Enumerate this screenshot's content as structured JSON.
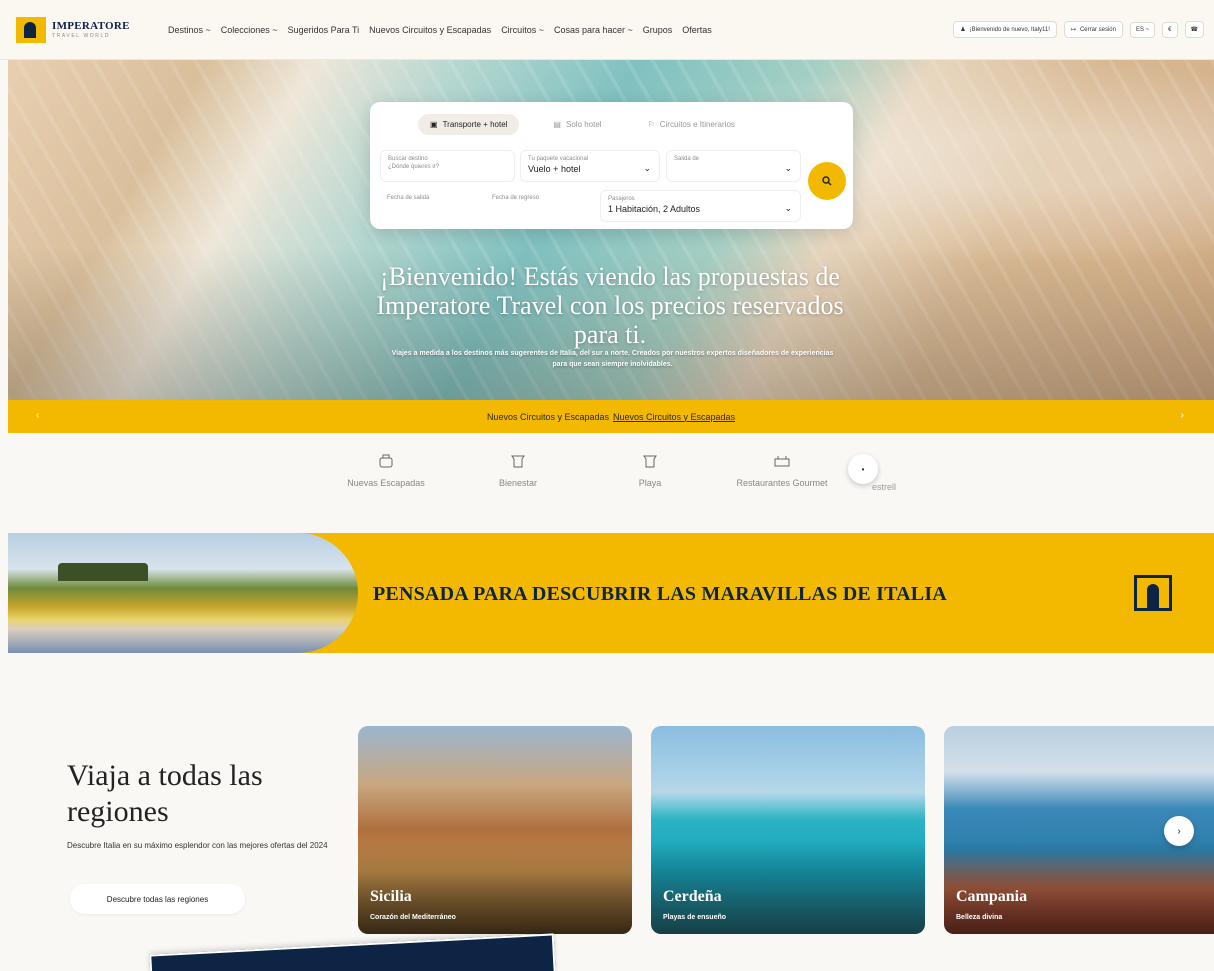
{
  "header": {
    "logo": {
      "name": "IMPERATORE",
      "sub": "TRAVEL WORLD"
    },
    "nav": [
      "Destinos ~",
      "Colecciones ~",
      "Sugeridos Para Ti",
      "Nuevos Circuitos y Escapadas",
      "Circuitos ~",
      "Cosas para hacer ~",
      "Grupos",
      "Ofertas"
    ],
    "welcome": "¡Bienvenido de nuevo, Italy11!",
    "logout": "Cerrar sesión",
    "lang": "ES ~",
    "currency": "€"
  },
  "hero": {
    "tabs": [
      "Transporte + hotel",
      "Solo hotel",
      "Circuitos e Itinerarios"
    ],
    "fields": {
      "destination": {
        "label": "Buscar destino",
        "placeholder": "¿Dónde quieres ir?"
      },
      "package": {
        "label": "Tu paquete vacacional",
        "value": "Vuelo + hotel"
      },
      "departure": {
        "label": "Salida de",
        "value": ""
      },
      "date_out": {
        "label": "Fecha de salida"
      },
      "date_back": {
        "label": "Fecha de regreso"
      },
      "passengers": {
        "label": "Pasajeros",
        "value": "1 Habitación, 2 Adultos"
      }
    },
    "title": "¡Bienvenido! Estás viendo las propuestas de Imperatore Travel con los precios reservados para ti.",
    "subtitle": "Viajes a medida a los destinos más sugerentes de Italia, del sur a norte. Creados por nuestros expertos diseñadores de experiencias para que sean siempre inolvidables."
  },
  "promo": {
    "text": "Nuevos Circuitos y Escapadas",
    "link": "Nuevos Circuitos y Escapadas"
  },
  "categories": [
    "Nuevas Escapadas",
    "Bienestar",
    "Playa",
    "Restaurantes Gourmet"
  ],
  "category_peek": "estrell",
  "banner": {
    "title": "PENSADA PARA DESCUBRIR LAS MARAVILLAS DE ITALIA"
  },
  "regions": {
    "title": "Viaja a todas las regiones",
    "description": "Descubre Italia en su máximo esplendor con las mejores ofertas del 2024",
    "button": "Descubre todas las regiones",
    "cards": [
      {
        "name": "Sicilia",
        "subtitle": "Corazón del Mediterráneo"
      },
      {
        "name": "Cerdeña",
        "subtitle": "Playas de ensueño"
      },
      {
        "name": "Campania",
        "subtitle": "Belleza divina"
      }
    ]
  },
  "colors": {
    "accent": "#f3b800",
    "navy": "#0d2444"
  }
}
